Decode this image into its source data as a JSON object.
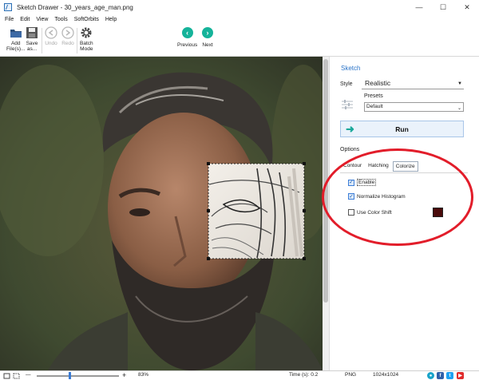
{
  "window": {
    "title": "Sketch Drawer - 30_years_age_man.png",
    "minimize": "—",
    "maximize": "☐",
    "close": "✕"
  },
  "menu": [
    "File",
    "Edit",
    "View",
    "Tools",
    "SoftOrbits",
    "Help"
  ],
  "toolbar": {
    "add_files": "Add\nFile(s)...",
    "save_as": "Save\nas...",
    "undo": "Undo",
    "redo": "Redo",
    "batch_mode": "Batch\nMode",
    "previous": "Previous",
    "next": "Next"
  },
  "panel": {
    "title": "Sketch",
    "style_label": "Style",
    "style_value": "Realistic",
    "presets_label": "Presets",
    "presets_value": "Default",
    "run_label": "Run",
    "options_label": "Options",
    "tabs": [
      "Contour",
      "Hatching",
      "Colorize"
    ],
    "active_tab": "Colorize",
    "enable_label": "Enable",
    "normalize_label": "Normalize Histogram",
    "color_shift_label": "Use Color Shift",
    "enable_checked": true,
    "normalize_checked": true,
    "color_shift_checked": false,
    "color_shift_value": "#4a0b0b"
  },
  "status": {
    "zoom_minus": "—",
    "zoom_plus": "+",
    "zoom_value": "83%",
    "zoom_fraction": 0.83,
    "time": "Time (s): 0.2",
    "format": "PNG",
    "dimensions": "1024x1024"
  },
  "colors": {
    "accent": "#2a73c8",
    "nav": "#15b39a",
    "annotation": "#e21d2a"
  }
}
